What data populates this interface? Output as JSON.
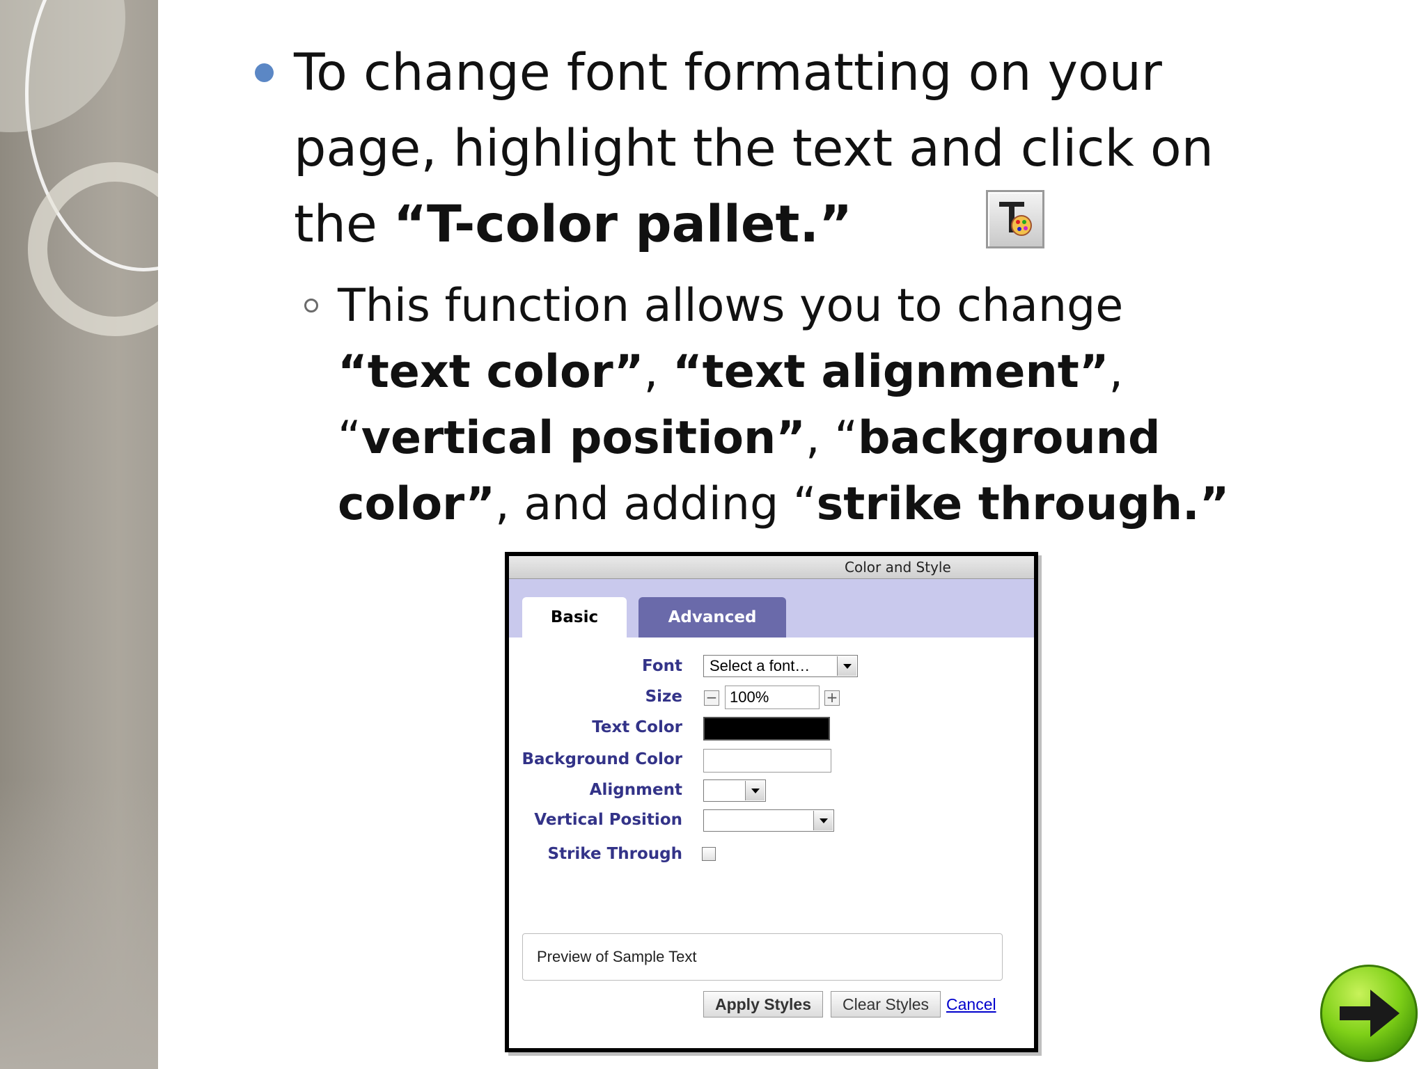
{
  "slide": {
    "bullet1": {
      "line1": "To change font formatting on your",
      "line2": "page, highlight the text and click on",
      "line3_prefix": "the ",
      "line3_bold": "“T-color pallet.”"
    },
    "bullet2": {
      "p1": "This function allows you to change ",
      "b1": "“text color”",
      "p2": ", ",
      "b2": "“text alignment”",
      "p3": ", “",
      "b3": "vertical position”",
      "p4": ", “",
      "b4": "background color”",
      "p5": ", and adding “",
      "b5": "strike through.”"
    }
  },
  "dialog": {
    "title": "Color and Style",
    "tabs": [
      "Basic",
      "Advanced"
    ],
    "labels": {
      "font": "Font",
      "size": "Size",
      "text_color": "Text Color",
      "background_color": "Background Color",
      "alignment": "Alignment",
      "vertical_position": "Vertical Position",
      "strike_through": "Strike Through"
    },
    "font_select_value": "Select a font…",
    "size_value": "100%",
    "size_minus": "−",
    "size_plus": "+",
    "text_color_value": "#000000",
    "preview_text": "Preview of Sample Text",
    "apply_label": "Apply Styles",
    "clear_label": "Clear Styles",
    "cancel_label": "Cancel"
  },
  "colors": {
    "bullet_dot": "#5b87c5",
    "tab_strip": "#c9c9ed",
    "tab_advanced": "#6a6aaa",
    "label_text": "#333388"
  },
  "icons": [
    "t-color-pallet-icon",
    "next-arrow-icon",
    "dropdown-arrow-icon"
  ]
}
